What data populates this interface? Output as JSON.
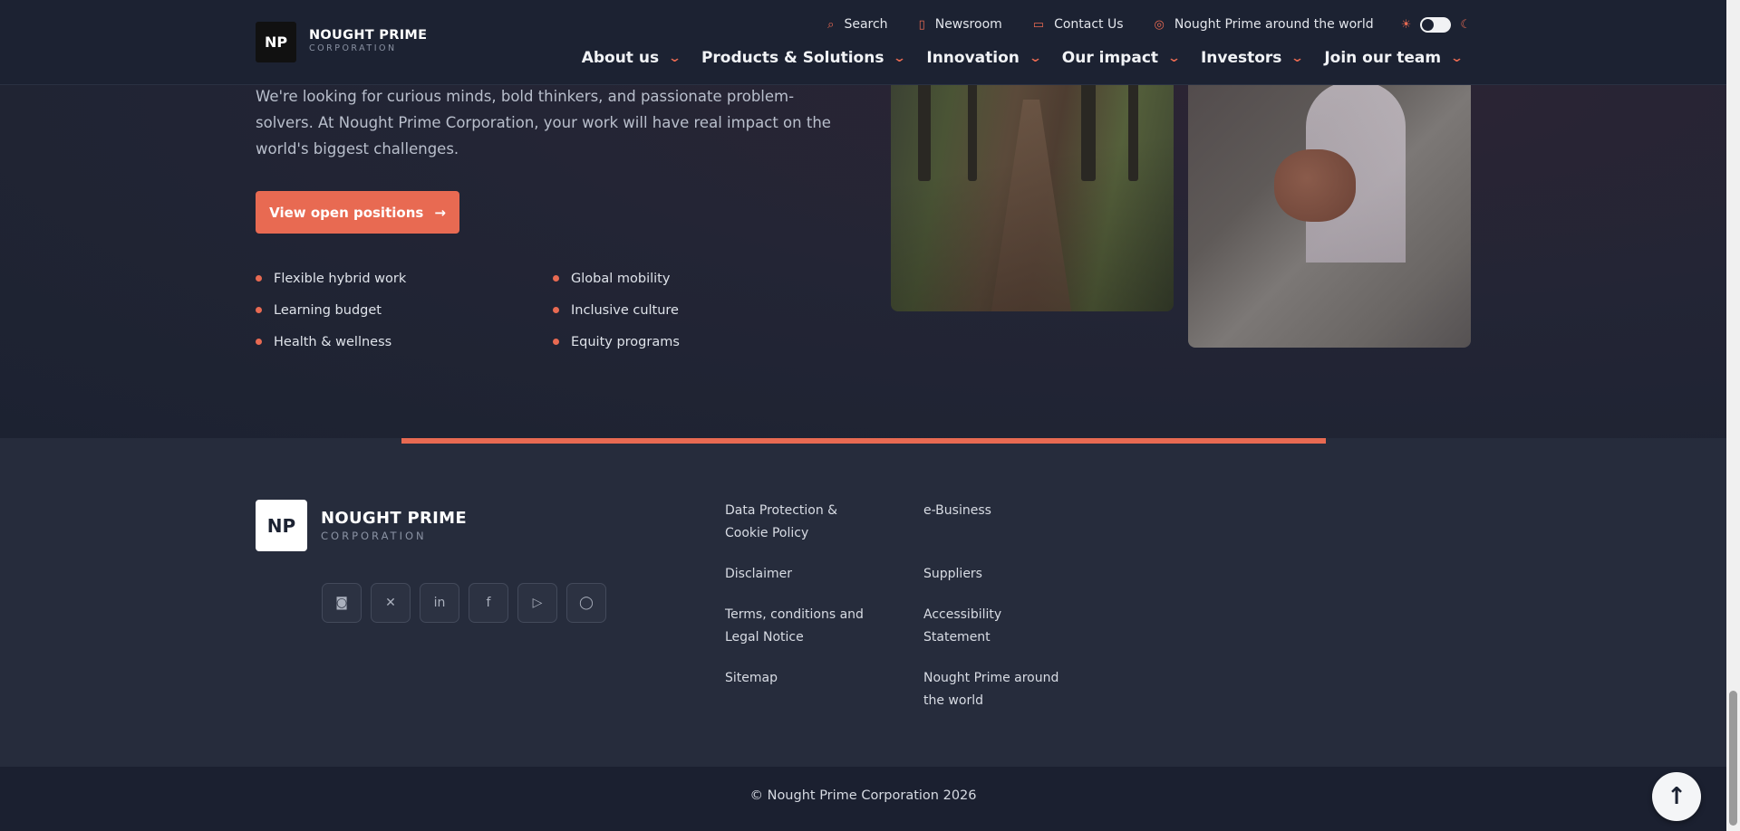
{
  "header": {
    "logo_mark": "NP",
    "logo_name": "NOUGHT PRIME",
    "logo_sub": "CORPORATION",
    "utility": {
      "search": "Search",
      "newsroom": "Newsroom",
      "contact": "Contact Us",
      "global": "Nought Prime around the world"
    },
    "nav": [
      "About us",
      "Products & Solutions",
      "Innovation",
      "Our impact",
      "Investors",
      "Join our team"
    ]
  },
  "hero": {
    "text": "We're looking for curious minds, bold thinkers, and passionate problem-solvers. At Nought Prime Corporation, your work will have real impact on the world's biggest challenges.",
    "cta_label": "View open positions",
    "benefits": [
      "Flexible hybrid work",
      "Global mobility",
      "Learning budget",
      "Inclusive culture",
      "Health & wellness",
      "Equity programs"
    ]
  },
  "footer": {
    "logo_mark": "NP",
    "logo_name": "NOUGHT PRIME",
    "logo_sub": "CORPORATION",
    "links": [
      "Data Protection & Cookie Policy",
      "e-Business",
      "Disclaimer",
      "Suppliers",
      "Terms, conditions and Legal Notice",
      "Accessibility Statement",
      "Sitemap",
      "Nought Prime around the world"
    ],
    "copyright": "© Nought Prime Corporation 2026"
  },
  "colors": {
    "accent": "#e86a52",
    "background": "#1c2231",
    "footer_bg": "#262c3c"
  },
  "icons": {
    "socials": [
      "instagram-icon",
      "x-icon",
      "linkedin-icon",
      "facebook-icon",
      "youtube-icon",
      "chat-icon"
    ]
  }
}
